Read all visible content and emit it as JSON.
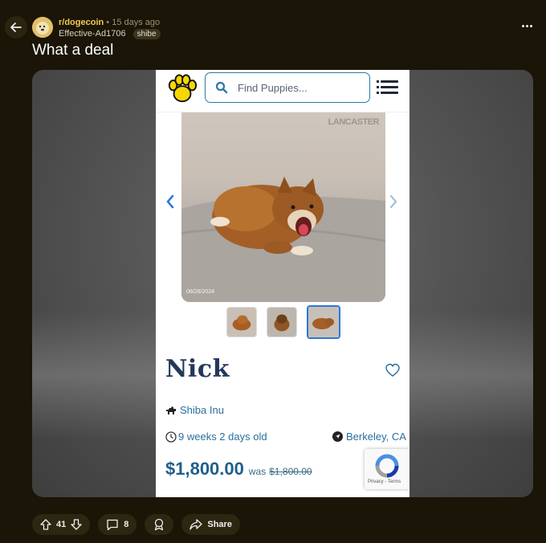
{
  "post": {
    "subreddit": "r/dogecoin",
    "age": "15 days ago",
    "author": "Effective-Ad1706",
    "flair": "shibe",
    "title": "What a deal"
  },
  "listing": {
    "search_placeholder": "Find Puppies...",
    "watermark": "LANCASTER",
    "photo_date": "08/28/2024",
    "name": "Nick",
    "breed": "Shiba Inu",
    "age": "9 weeks 2 days old",
    "location": "Berkeley, CA",
    "price": "$1,800.00",
    "was_label": "was",
    "old_price": "$1,800.00",
    "recaptcha_links": "Privacy - Terms"
  },
  "actions": {
    "upvotes": "41",
    "comments": "8",
    "share_label": "Share"
  },
  "colors": {
    "background": "#1a1506",
    "subreddit": "#f0c85a",
    "price": "#1f5f8c",
    "name": "#22385a",
    "accent_blue": "#2b78a8"
  }
}
